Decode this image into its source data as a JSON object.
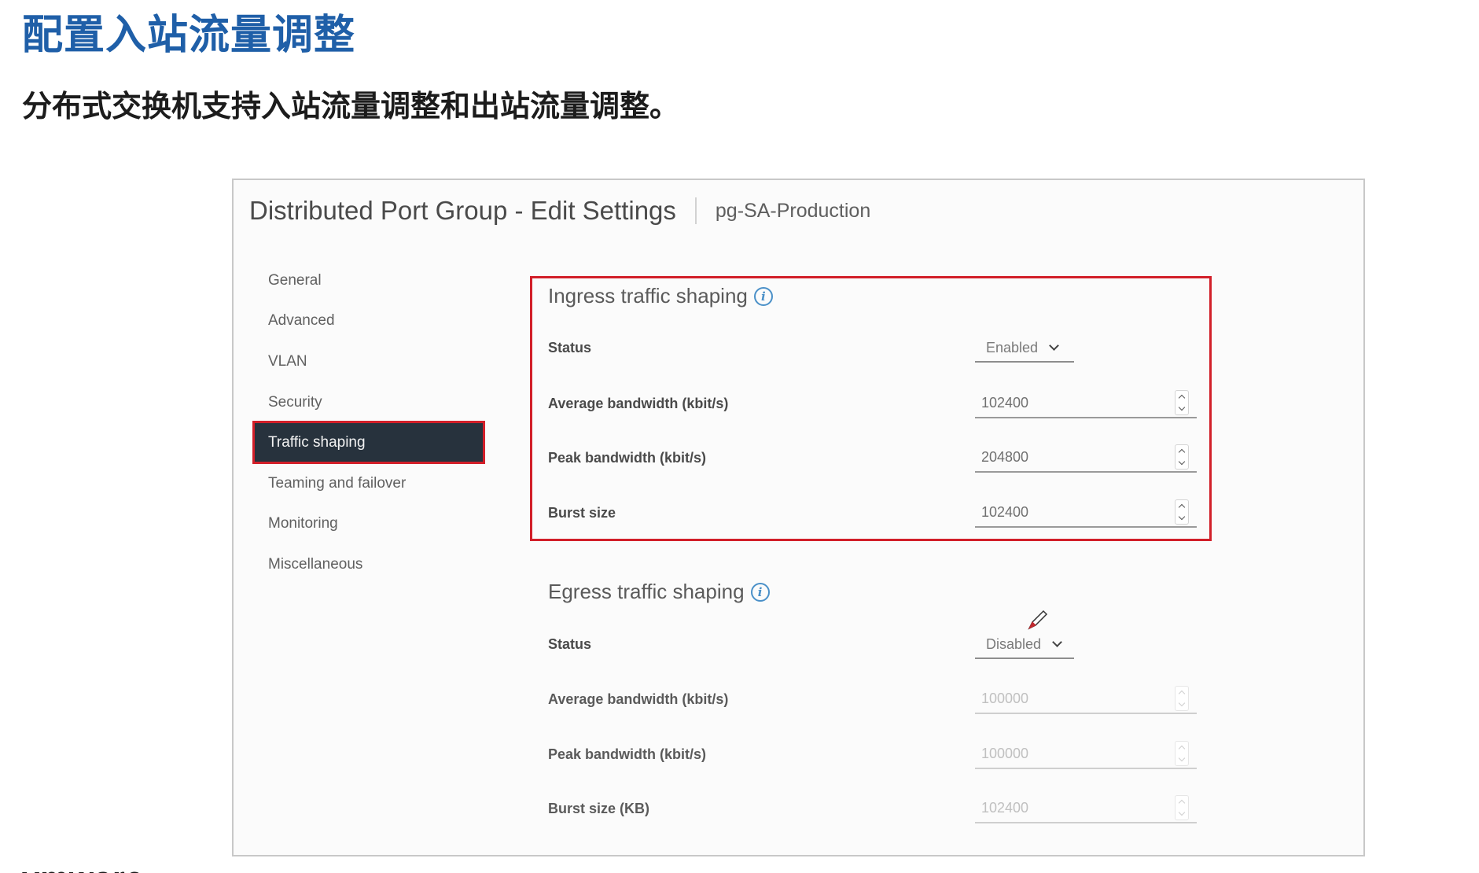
{
  "slide": {
    "title": "配置入站流量调整",
    "subtitle": "分布式交换机支持入站流量调整和出站流量调整。",
    "brand": "vmware"
  },
  "dialog": {
    "title": "Distributed Port Group - Edit Settings",
    "subtitle": "pg-SA-Production"
  },
  "nav": {
    "items": [
      {
        "label": "General"
      },
      {
        "label": "Advanced"
      },
      {
        "label": "VLAN"
      },
      {
        "label": "Security"
      },
      {
        "label": "Traffic shaping"
      },
      {
        "label": "Teaming and failover"
      },
      {
        "label": "Monitoring"
      },
      {
        "label": "Miscellaneous"
      }
    ],
    "active": "Traffic shaping"
  },
  "ingress": {
    "title": "Ingress traffic shaping",
    "status_label": "Status",
    "status_value": "Enabled",
    "avg_label": "Average bandwidth (kbit/s)",
    "avg_value": "102400",
    "peak_label": "Peak bandwidth (kbit/s)",
    "peak_value": "204800",
    "burst_label": "Burst size",
    "burst_value": "102400"
  },
  "egress": {
    "title": "Egress traffic shaping",
    "status_label": "Status",
    "status_value": "Disabled",
    "avg_label": "Average bandwidth (kbit/s)",
    "avg_value": "100000",
    "peak_label": "Peak bandwidth (kbit/s)",
    "peak_value": "100000",
    "burst_label": "Burst size (KB)",
    "burst_value": "102400"
  },
  "colors": {
    "title_blue": "#1f5fa8",
    "highlight_red": "#d21f29",
    "nav_active_bg": "#27323d",
    "info_blue": "#4a90c8"
  },
  "icons": {
    "info": "info-circle-icon",
    "dropdown": "chevron-down-icon",
    "stepper": "spinner-icon",
    "cursor": "pencil-cursor-icon"
  }
}
